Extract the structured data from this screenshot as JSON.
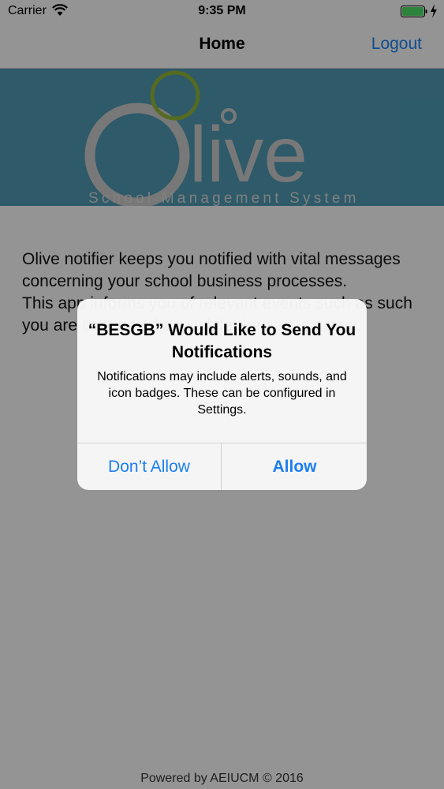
{
  "status_bar": {
    "carrier": "Carrier",
    "time": "9:35 PM",
    "wifi_icon": "wifi-icon",
    "battery_icon": "battery-icon"
  },
  "nav": {
    "title": "Home",
    "logout_label": "Logout"
  },
  "banner": {
    "logo_text": "live",
    "logo_letter": "O",
    "subtitle": "School Management System"
  },
  "content": {
    "paragraph_1": "Olive notifier keeps you notified with vital messages concerning your school business processes.",
    "paragraph_2": "This app informs you of relevant events such as such you are connected and while the app is active."
  },
  "footer": {
    "text": "Powered by AEIUCM © 2016"
  },
  "alert": {
    "title": "“BESGB” Would Like to Send You Notifications",
    "message": "Notifications may include alerts, sounds, and icon badges. These can be configured in Settings.",
    "deny_label": "Don’t Allow",
    "allow_label": "Allow"
  },
  "colors": {
    "accent": "#1b7ff0",
    "banner": "#4d97b0",
    "logo_green": "#8fb33a",
    "logo_gray": "#c9c9c9"
  }
}
